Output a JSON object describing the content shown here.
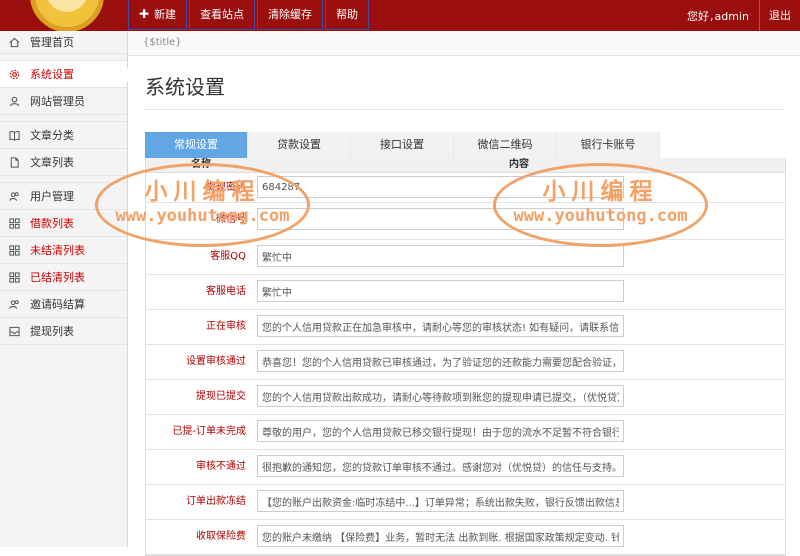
{
  "topbar": {
    "buttons": [
      {
        "label": "新建",
        "icon": "plus-icon"
      },
      {
        "label": "查看站点"
      },
      {
        "label": "清除缓存"
      },
      {
        "label": "帮助"
      }
    ],
    "greeting": "您好",
    "username": "admin",
    "logout": "退出"
  },
  "sidebar": {
    "items": [
      {
        "label": "管理首页",
        "icon": "home-icon"
      },
      {
        "label": "系统设置",
        "icon": "gear-icon",
        "active": true
      },
      {
        "label": "网站管理员",
        "icon": "user-icon"
      },
      {
        "label": "文章分类",
        "icon": "book-icon"
      },
      {
        "label": "文章列表",
        "icon": "document-icon"
      },
      {
        "label": "用户管理",
        "icon": "users-icon"
      },
      {
        "label": "借款列表",
        "icon": "grid-icon",
        "highlight": true
      },
      {
        "label": "未结清列表",
        "icon": "grid-icon",
        "highlight": true
      },
      {
        "label": "已结清列表",
        "icon": "grid-icon",
        "highlight": true
      },
      {
        "label": "邀请码结算",
        "icon": "users-icon"
      },
      {
        "label": "提现列表",
        "icon": "inbox-icon"
      }
    ]
  },
  "main": {
    "breadcrumb": "{$title}",
    "title": "系统设置",
    "tabs": [
      "常规设置",
      "贷款设置",
      "接口设置",
      "微信二维码",
      "银行卡账号"
    ],
    "table": {
      "headers": [
        "名称",
        "内容"
      ],
      "rows": [
        {
          "label": "提现密码",
          "value": "684287"
        },
        {
          "label": "微信号",
          "value": ""
        },
        {
          "label": "客服QQ",
          "value": "繁忙中"
        },
        {
          "label": "客服电话",
          "value": "繁忙中"
        },
        {
          "label": "正在审核",
          "value": "您的个人信用贷款正在加急审核中，请耐心等您的审核状态! 如有疑问，请联系信贷员咨询..."
        },
        {
          "label": "设置审核通过",
          "value": "恭喜您！您的个人信用贷款已审核通过，为了验证您的还款能力需要您配合验证，验证完成即可:"
        },
        {
          "label": "提现已提交",
          "value": "您的个人信用贷款出款成功，请耐心等待款项到账您的提现申请已提交，（优悦贷）平台我"
        },
        {
          "label": "已提-订单未完成",
          "value": "尊敬的用户，您的个人信用贷款已移交银行提现！由于您的流水不足暂不符合银行出款条例规定"
        },
        {
          "label": "审核不通过",
          "value": "很抱歉的通知您，您的贷款订单审核不通过。感谢您对（优悦贷）的信任与支持。"
        },
        {
          "label": "订单出款冻结",
          "value": "【您的账户出款资金:临时冻结中...】订单异常；系统出款失败，银行反馈出款信息错误，导致该"
        },
        {
          "label": "收取保险费",
          "value": "您的账户未缴纳 【保险费】业务，暂时无法 出款到账. 根据国家政策规定变动. 针对小额贷款平台"
        }
      ]
    }
  },
  "watermarks": [
    {
      "line1": "小川编程",
      "line2": "www.youhutong.com"
    },
    {
      "line1": "小川编程",
      "line2": "www.youhutong.com"
    }
  ],
  "colors": {
    "topbar": "#9b0e0e",
    "tab_active": "#63a6e6",
    "label_red": "#b00000",
    "watermark": "#f2a266"
  }
}
